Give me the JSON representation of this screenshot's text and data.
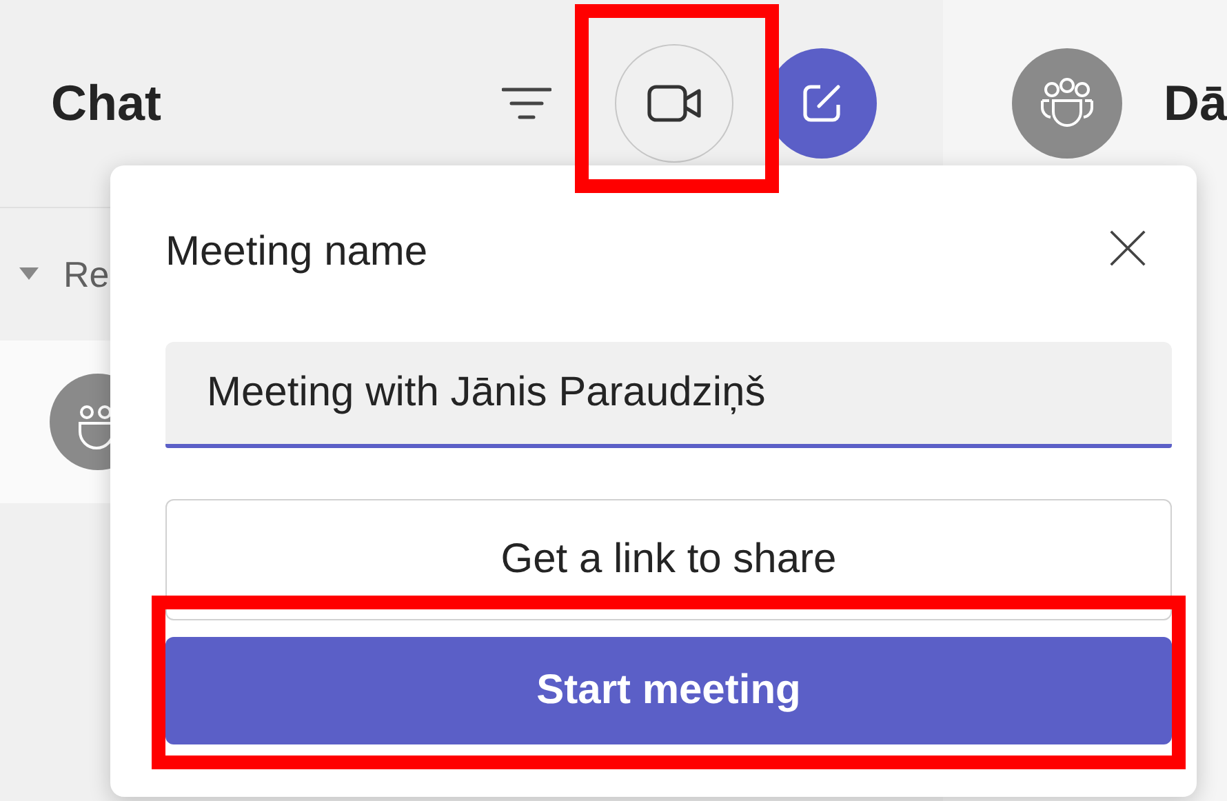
{
  "chat_pane": {
    "title": "Chat",
    "section": {
      "label": "Re",
      "expanded": true
    }
  },
  "conversation": {
    "title": "Dā"
  },
  "meeting_popup": {
    "label": "Meeting name",
    "name_field": {
      "value": "Meeting with Jānis Paraudziņš"
    },
    "link_button": "Get a link to share",
    "start_button": "Start meeting"
  }
}
